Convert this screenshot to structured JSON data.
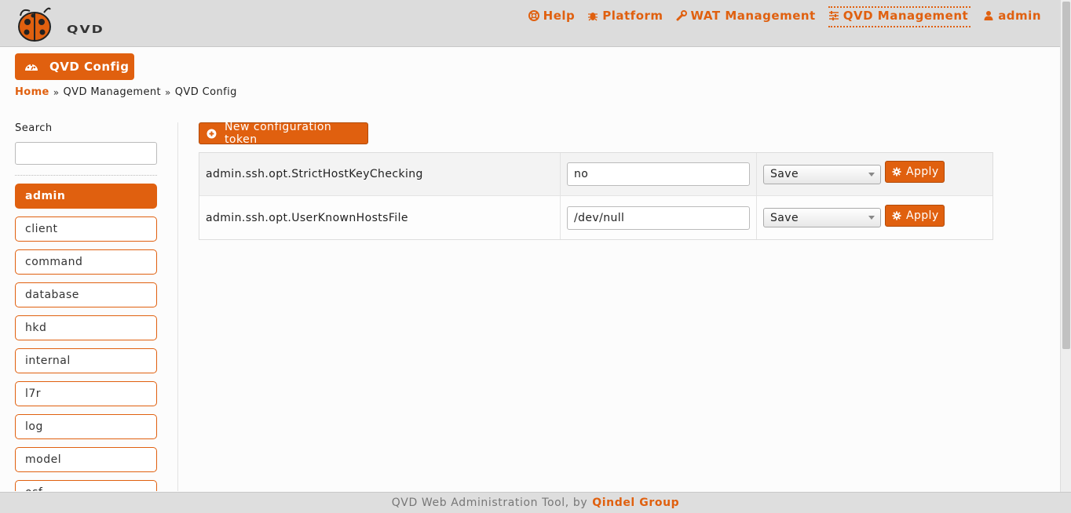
{
  "app": {
    "logo_text": "QVD",
    "brand_color": "#e0600f"
  },
  "nav": [
    {
      "label": "Help",
      "icon": "lifebuoy-icon"
    },
    {
      "label": "Platform",
      "icon": "bug-icon"
    },
    {
      "label": "WAT Management",
      "icon": "wrench-icon"
    },
    {
      "label": "QVD Management",
      "icon": "sliders-icon",
      "active": true
    },
    {
      "label": "admin",
      "icon": "user-icon"
    }
  ],
  "page": {
    "title": "QVD Config",
    "title_icon": "dashboard-icon"
  },
  "breadcrumb": {
    "home": "Home",
    "level1": "QVD Management",
    "level2": "QVD Config"
  },
  "sidebar": {
    "search_label": "Search",
    "search_value": "",
    "items": [
      {
        "label": "admin",
        "active": true
      },
      {
        "label": "client"
      },
      {
        "label": "command"
      },
      {
        "label": "database"
      },
      {
        "label": "hkd"
      },
      {
        "label": "internal"
      },
      {
        "label": "l7r"
      },
      {
        "label": "log"
      },
      {
        "label": "model"
      },
      {
        "label": "osf"
      }
    ]
  },
  "main": {
    "new_button_label": "New configuration token",
    "tokens": [
      {
        "key": "admin.ssh.opt.StrictHostKeyChecking",
        "value": "no",
        "action": "Save",
        "apply_label": "Apply"
      },
      {
        "key": "admin.ssh.opt.UserKnownHostsFile",
        "value": "/dev/null",
        "action": "Save",
        "apply_label": "Apply"
      }
    ]
  },
  "footer": {
    "text": "QVD Web Administration Tool, by",
    "brand": "Qindel Group"
  }
}
